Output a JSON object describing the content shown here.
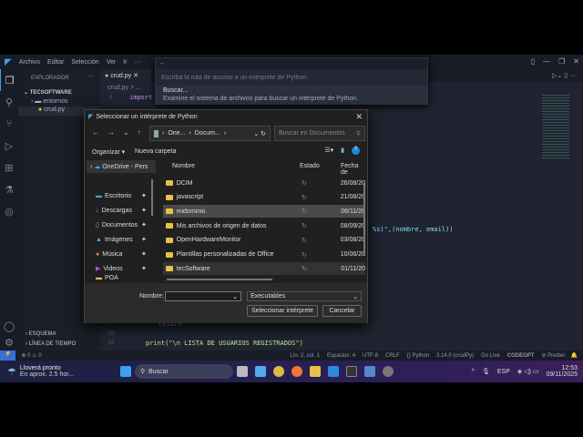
{
  "vscode": {
    "menu": [
      "Archivo",
      "Editar",
      "Selección",
      "Ver",
      "Ir",
      "···"
    ],
    "explorer_title": "EXPLORADOR",
    "explorer_more": "···",
    "project": "TECSOFTWARE",
    "tree": [
      {
        "label": "entornos",
        "type": "folder"
      },
      {
        "label": "crud.py",
        "type": "file"
      }
    ],
    "outline": "ESQUEMA",
    "timeline": "LÍNEA DE TIEMPO",
    "tab": "crud.py",
    "breadcrumb": "crud.py > ...",
    "code": [
      {
        "ln": "1",
        "text": "import"
      },
      {
        "ln": "",
        "text": "%s)\",(nombre, email))"
      },
      {
        "ln": "27",
        "text": "return"
      },
      {
        "ln": "28",
        "text": ""
      },
      {
        "ln": "29",
        "text": "print(\"\\n LISTA DE USUARIOS REGISTRADOS\")"
      }
    ]
  },
  "palette": {
    "placeholder": "Escriba la ruta de acceso a un intérprete de Python.",
    "item_title": "Buscar...",
    "item_desc": "Examine el sistema de archivos para buscar un intérprete de Python."
  },
  "dialog": {
    "title": "Seleccionar un intérprete de Python",
    "path": [
      "One...",
      "Docum..."
    ],
    "search_placeholder": "Buscar en Documentos",
    "organize": "Organizar ▾",
    "new_folder": "Nueva carpeta",
    "nav": [
      {
        "label": "OneDrive - Pers"
      },
      {
        "label": "Escritorio"
      },
      {
        "label": "Descargas"
      },
      {
        "label": "Documentos"
      },
      {
        "label": "Imágenes"
      },
      {
        "label": "Música"
      },
      {
        "label": "Videos"
      },
      {
        "label": "POA"
      }
    ],
    "columns": [
      "Nombre",
      "Estado",
      "Fecha de"
    ],
    "files": [
      {
        "name": "DCIM",
        "date": "26/08/20"
      },
      {
        "name": "javascript",
        "date": "21/08/20"
      },
      {
        "name": "midominio",
        "date": "06/11/20"
      },
      {
        "name": "Mis archivos de origen de datos",
        "date": "08/09/20"
      },
      {
        "name": "OpenHardwareMonitor",
        "date": "03/08/20"
      },
      {
        "name": "Plantillas personalizadas de Office",
        "date": "10/06/20"
      },
      {
        "name": "tecSoftware",
        "date": "01/11/20"
      }
    ],
    "name_label": "Nombre:",
    "name_value": "",
    "filter": "Executables",
    "ok": "Seleccionar intérprete",
    "cancel": "Cancelar"
  },
  "status": {
    "problems": "⊗ 0 ⚠ 0",
    "position": "Lín. 2, col. 1",
    "spaces": "Espacios: 4",
    "encoding": "UTF-8",
    "eol": "CRLF",
    "language": "{} Python",
    "interpreter": "3.14.0 (crudPy)",
    "golive": "Go Live",
    "codegpt": "CODEGPT",
    "prettier": "⊘ Prettier"
  },
  "taskbar": {
    "weather_title": "Lloverá pronto",
    "weather_sub": "En aprox. 2.5 hor...",
    "search": "Buscar",
    "lang": "ESP",
    "time": "12:53",
    "date": "09/11/2025"
  }
}
